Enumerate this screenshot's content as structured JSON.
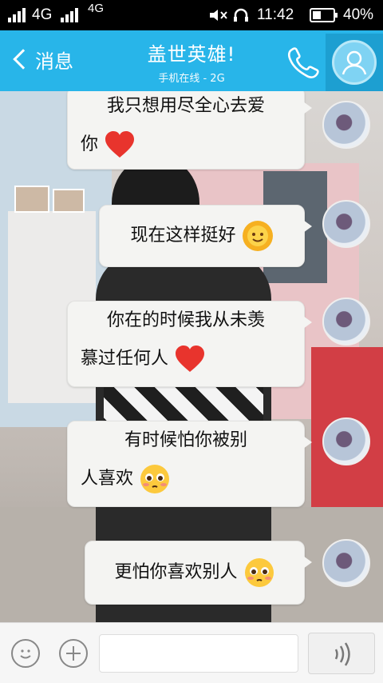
{
  "status_bar": {
    "net1": "4G",
    "net2": "4G",
    "time": "11:42",
    "battery": "40%",
    "battery_level": 0.4
  },
  "header": {
    "back_label": "消息",
    "title": "盖世英雄!",
    "subtitle": "手机在线 - 2G"
  },
  "messages": [
    {
      "line1": "我只想用尽全心去爱",
      "line2": "你",
      "emoji": "heart"
    },
    {
      "line1": "现在这样挺好",
      "emoji": "sun-smile"
    },
    {
      "line1": "你在的时候我从未羡",
      "line2": "慕过任何人",
      "emoji": "heart"
    },
    {
      "line1": "有时候怕你被别",
      "line2": "人喜欢",
      "emoji": "pleading-face"
    },
    {
      "line1": "更怕你喜欢别人",
      "emoji": "pleading-face"
    }
  ],
  "input_bar": {
    "placeholder": ""
  },
  "colors": {
    "header_bg": "#28b5e9",
    "status_bg": "#000000",
    "bubble_bg": "#f4f4f2"
  }
}
